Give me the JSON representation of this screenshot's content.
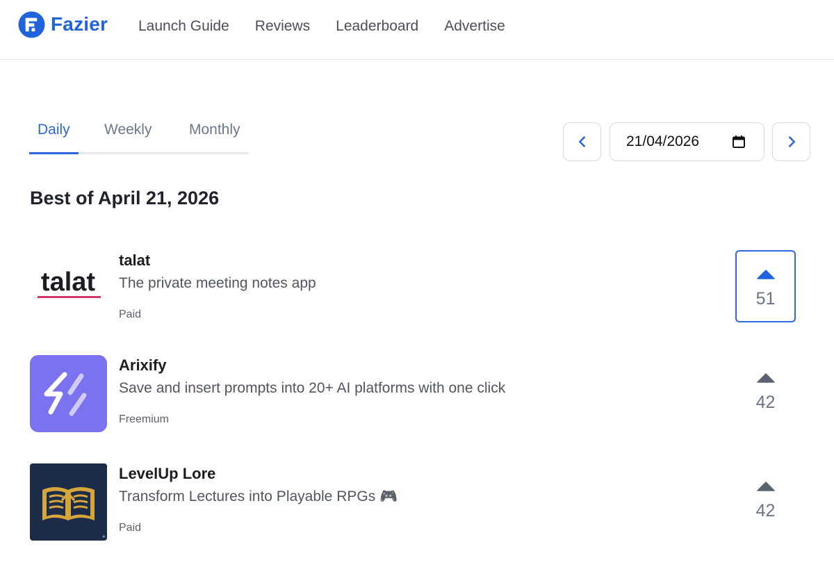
{
  "header": {
    "brand": "Fazier",
    "nav": [
      "Launch Guide",
      "Reviews",
      "Leaderboard",
      "Advertise"
    ]
  },
  "tabs": [
    "Daily",
    "Weekly",
    "Monthly"
  ],
  "active_tab": "Daily",
  "date": {
    "value": "21/04/2026"
  },
  "section_title": "Best of April 21, 2026",
  "products": [
    {
      "name": "talat",
      "description": "The private meeting notes app",
      "pricing": "Paid",
      "votes": "51",
      "voted": true,
      "logo_text": "talat"
    },
    {
      "name": "Arixify",
      "description": "Save and insert prompts into 20+ AI platforms with one click",
      "pricing": "Freemium",
      "votes": "42",
      "voted": false
    },
    {
      "name": "LevelUp Lore",
      "description": "Transform Lectures into Playable RPGs 🎮",
      "pricing": "Paid",
      "votes": "42",
      "voted": false
    }
  ],
  "colors": {
    "brand": "#1f63dd",
    "accent": "#2f66db",
    "arixify_bg": "#7b72f0",
    "levelup_bg": "#1c2b47",
    "levelup_gold": "#d6a53b"
  }
}
